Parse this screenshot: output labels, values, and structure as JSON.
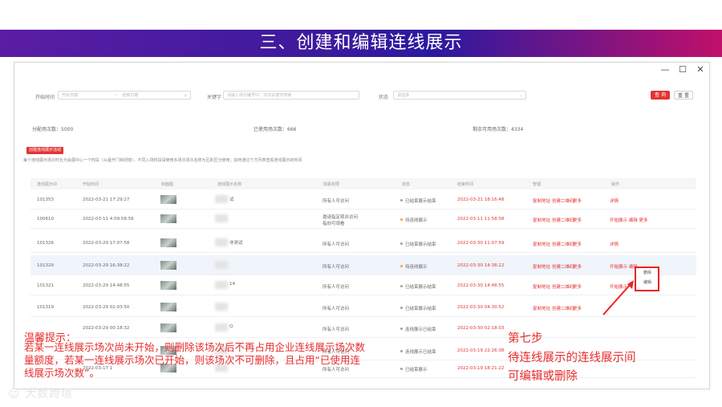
{
  "banner": {
    "title": "三、创建和编辑连线展示"
  },
  "window": {
    "min": "—",
    "max": "☐",
    "close": "✕"
  },
  "filters": {
    "date_label": "开始时间",
    "date_start_placeholder": "开始日期",
    "date_sep": "~",
    "date_end_placeholder": "结束日期",
    "keyword_label": "关键字",
    "keyword_placeholder": "请输入场次编号ID、内容关键字搜索",
    "status_label": "状态",
    "status_placeholder": "请选择",
    "search_btn": "查 询",
    "reset_btn": "重 置"
  },
  "stats": {
    "allocated": "分配场次数：5000",
    "used": "已使用场次数：666",
    "remaining": "剩余可用场次数：4334"
  },
  "create_btn": "创建连线展示活动",
  "notice": "每个连线展示场次时长为会展中心一个时段（从最开门到闭馆），不同入场时段请使用多场次场次名称为区别区分使用；如何通过下方列表查看连线展示的时间",
  "table": {
    "headers": [
      "连线展示ID",
      "开始时间",
      "封面图",
      "连线展示名称",
      "观看权限",
      "状态",
      "结束时间",
      "管理",
      "操作"
    ],
    "rows": [
      {
        "id": "101353",
        "start": "2022-03-21 17:29:27",
        "name": "试",
        "perm": "所有人可访问",
        "status": "已结束展示结束",
        "status_color": "#a0a0a0",
        "end": "2022-03-21 18:16:48",
        "op": "详情"
      },
      {
        "id": "100610",
        "start": "2022-03-11 4:09:58:56",
        "name": "",
        "perm": "邀请指定观众访问",
        "perm2": "指向可观看",
        "status": "待连线展示",
        "status_color": "#f5a623",
        "end": "2022-03-11 11:58:58",
        "op": "开始展示  编辑  更多"
      },
      {
        "id": "101326",
        "start": "2022-03-29 17:07:58",
        "name": "非测试",
        "perm": "所有人可访问",
        "status": "已结束展示结束",
        "status_color": "#a0a0a0",
        "end": "2022-03-30 11:07:59",
        "op": "详情"
      },
      {
        "id": "101329",
        "start": "2022-03-29 16:38:22",
        "name": "",
        "perm": "所有人可访问",
        "status": "待连线展示",
        "status_color": "#f5a623",
        "end": "2022-03-30 14:38:22",
        "op": "开始展示  编辑"
      },
      {
        "id": "101321",
        "start": "2022-03-29 14:48:55",
        "name": "14",
        "perm": "所有人可访问",
        "status": "已结束展示结束",
        "status_color": "#a0a0a0",
        "end": "2022-03-30 14:48:55",
        "op": "开始展示"
      },
      {
        "id": "101319",
        "start": "2022-03-29 02:03:50",
        "name": "",
        "perm": "所有人可访问",
        "status": "已结束展示结束",
        "status_color": "#a0a0a0",
        "end": "2022-03-30 04:30:52",
        "op": ""
      },
      {
        "id": "",
        "start": "2022-03-29 00:18:32",
        "name": "Q",
        "perm": "所有人可访问",
        "status": "连线展示已结束",
        "status_color": "#a0a0a0",
        "end": "2022-03-30 02:18:03",
        "op": ""
      },
      {
        "id": "",
        "start": "",
        "name": "",
        "perm": "所有人可访问",
        "status": "连线展示已结束",
        "status_color": "#a0a0a0",
        "end": "2022-03-19 22:26:38",
        "op": ""
      },
      {
        "id": "",
        "start": "2022-03-17 1",
        "name": "",
        "perm": "所有人可访问",
        "status": "已结束展示",
        "status_color": "#a0a0a0",
        "end": "2022-03-19 18:21:22",
        "op": ""
      }
    ],
    "manage": {
      "a": "复制地址",
      "b": "创建二维码",
      "c": "更多"
    }
  },
  "popup": {
    "item1": "删除",
    "item2": "编辑"
  },
  "tip": {
    "title": "温馨提示：",
    "line1": "若某一连线展示场次尚未开始，则删除该场次后不再占用企业连线展示场次数",
    "line2": "量额度，若某一连线展示场次已开始，则该场次不可删除，且占用“已使用连",
    "line3": "线展示场次数”。"
  },
  "step": {
    "line1": "第七步",
    "line2": "待连线展示的连线展示间",
    "line3": "可编辑或删除"
  },
  "logo": {
    "text": "大数跨境"
  }
}
